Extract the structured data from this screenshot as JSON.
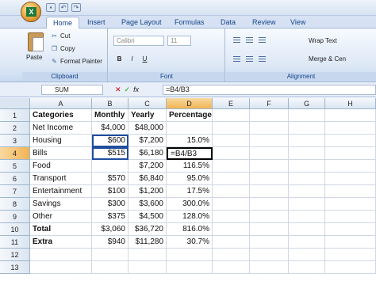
{
  "quick_access": [
    "save",
    "undo",
    "redo"
  ],
  "tabs": [
    {
      "label": "Home",
      "active": true
    },
    {
      "label": "Insert"
    },
    {
      "label": "Page Layout"
    },
    {
      "label": "Formulas"
    },
    {
      "label": "Data"
    },
    {
      "label": "Review"
    },
    {
      "label": "View"
    }
  ],
  "clipboard": {
    "paste": "Paste",
    "cut": "Cut",
    "copy": "Copy",
    "format_painter": "Format Painter",
    "group_label": "Clipboard"
  },
  "font": {
    "family": "Calibri",
    "size": "11",
    "group_label": "Font",
    "bold": "B",
    "italic": "I",
    "underline": "U"
  },
  "alignment": {
    "wrap_text": "Wrap Text",
    "merge_center": "Merge & Cen",
    "group_label": "Alignment"
  },
  "formula_bar": {
    "name_box": "SUM",
    "cancel": "✕",
    "enter": "✓",
    "fx": "fx",
    "formula": "=B4/B3"
  },
  "grid": {
    "columns": [
      "A",
      "B",
      "C",
      "D",
      "E",
      "F",
      "G",
      "H"
    ],
    "rows": [
      {
        "n": "1",
        "cells": [
          "Categories",
          "Monthly",
          "Yearly",
          "Percentage"
        ],
        "bold": true
      },
      {
        "n": "2",
        "cells": [
          "Net Income",
          "$4,000",
          "$48,000",
          ""
        ]
      },
      {
        "n": "3",
        "cells": [
          "Housing",
          "$600",
          "$7,200",
          "15.0%"
        ]
      },
      {
        "n": "4",
        "cells": [
          "Bills",
          "$515",
          "$6,180",
          "=B4/B3"
        ]
      },
      {
        "n": "5",
        "cells": [
          "Food",
          "",
          "$7,200",
          "116.5%"
        ]
      },
      {
        "n": "6",
        "cells": [
          "Transport",
          "$570",
          "$6,840",
          "95.0%"
        ]
      },
      {
        "n": "7",
        "cells": [
          "Entertainment",
          "$100",
          "$1,200",
          "17.5%"
        ]
      },
      {
        "n": "8",
        "cells": [
          "Savings",
          "$300",
          "$3,600",
          "300.0%"
        ]
      },
      {
        "n": "9",
        "cells": [
          "Other",
          "$375",
          "$4,500",
          "128.0%"
        ]
      },
      {
        "n": "10",
        "cells": [
          "Total",
          "$3,060",
          "$36,720",
          "816.0%"
        ],
        "bold_first": true
      },
      {
        "n": "11",
        "cells": [
          "Extra",
          "$940",
          "$11,280",
          "30.7%"
        ],
        "bold_first": true
      },
      {
        "n": "12",
        "cells": [
          "",
          "",
          "",
          ""
        ]
      },
      {
        "n": "13",
        "cells": [
          "",
          "",
          "",
          ""
        ]
      }
    ]
  }
}
